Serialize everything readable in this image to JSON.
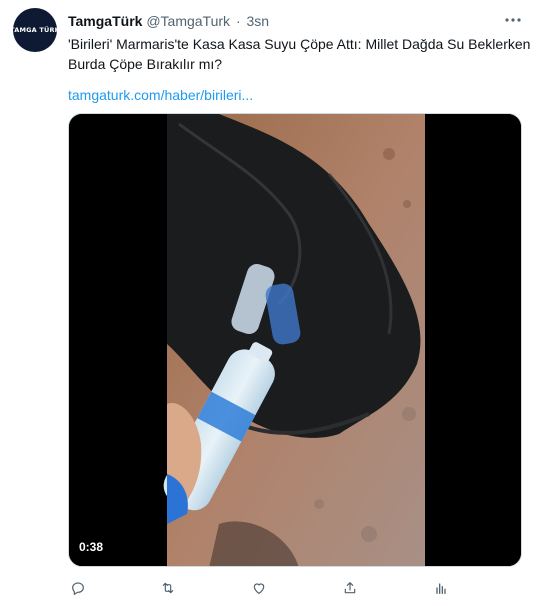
{
  "author": {
    "avatar_text": "TAMGA TÜRK",
    "display_name": "TamgaTürk",
    "handle": "@TamgaTurk",
    "separator": "·",
    "time": "3sn"
  },
  "tweet": {
    "text_line1": "'Birileri' Marmaris'te Kasa Kasa Suyu Çöpe Attı: Millet Dağda Su Beklerken",
    "text_line2": "Burda Çöpe Bırakılır mı?",
    "link": "tamgaturk.com/haber/birileri..."
  },
  "media": {
    "type": "video",
    "duration": "0:38"
  },
  "actions": {
    "icons": [
      "reply-icon",
      "retweet-icon",
      "like-icon",
      "share-icon",
      "analytics-icon"
    ]
  },
  "colors": {
    "link": "#1d9bf0",
    "secondary_text": "#536471",
    "icon": "#536471"
  }
}
